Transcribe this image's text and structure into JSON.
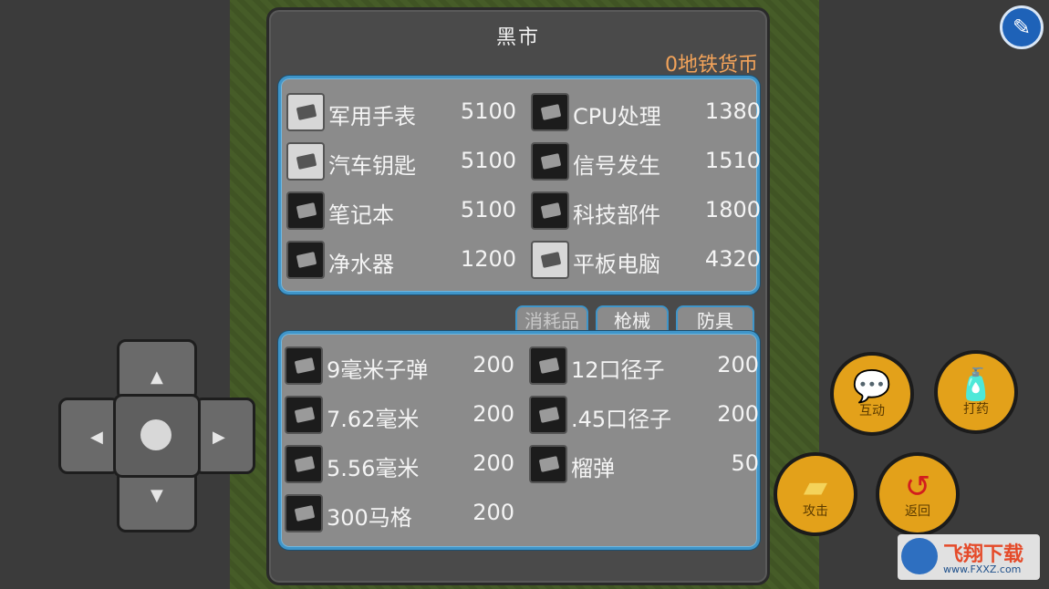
{
  "panel": {
    "title": "黑市",
    "currency": "0地铁货币"
  },
  "top_items": [
    {
      "name": "军用手表",
      "price": "5100",
      "icon": "watch-icon",
      "light": true
    },
    {
      "name": "CPU处理",
      "price": "1380",
      "icon": "cpu-icon",
      "light": false
    },
    {
      "name": "汽车钥匙",
      "price": "5100",
      "icon": "car-key-icon",
      "light": true
    },
    {
      "name": "信号发生",
      "price": "1510",
      "icon": "signal-generator-icon",
      "light": false
    },
    {
      "name": "笔记本",
      "price": "5100",
      "icon": "notebook-icon",
      "light": false
    },
    {
      "name": "科技部件",
      "price": "1800",
      "icon": "tech-part-icon",
      "light": false
    },
    {
      "name": "净水器",
      "price": "1200",
      "icon": "water-purifier-icon",
      "light": false
    },
    {
      "name": "平板电脑",
      "price": "4320",
      "icon": "tablet-icon",
      "light": true
    }
  ],
  "tabs": [
    {
      "label": "消耗品",
      "active": true
    },
    {
      "label": "枪械",
      "active": false
    },
    {
      "label": "防具",
      "active": false
    }
  ],
  "bottom_items": [
    {
      "name": "9毫米子弹",
      "price": "200",
      "icon": "ammo-box-icon"
    },
    {
      "name": "12口径子",
      "price": "200",
      "icon": "ammo-box-icon"
    },
    {
      "name": "7.62毫米",
      "price": "200",
      "icon": "ammo-box-icon"
    },
    {
      "name": ".45口径子",
      "price": "200",
      "icon": "ammo-box-icon"
    },
    {
      "name": "5.56毫米",
      "price": "200",
      "icon": "ammo-box-icon"
    },
    {
      "name": "榴弹",
      "price": "50",
      "icon": "grenade-icon"
    },
    {
      "name": "300马格",
      "price": "200",
      "icon": "ammo-box-icon"
    }
  ],
  "controls": {
    "interact_label": "互动",
    "heal_label": "打药",
    "attack_label": "攻击",
    "back_label": "返回"
  },
  "watermark": {
    "text": "飞翔下载",
    "url": "www.FXXZ.com"
  },
  "colors": {
    "currency": "#f2a35a",
    "box_border": "#3f95c9",
    "action_button": "#e3a11a",
    "settings_button": "#1e62b8"
  }
}
